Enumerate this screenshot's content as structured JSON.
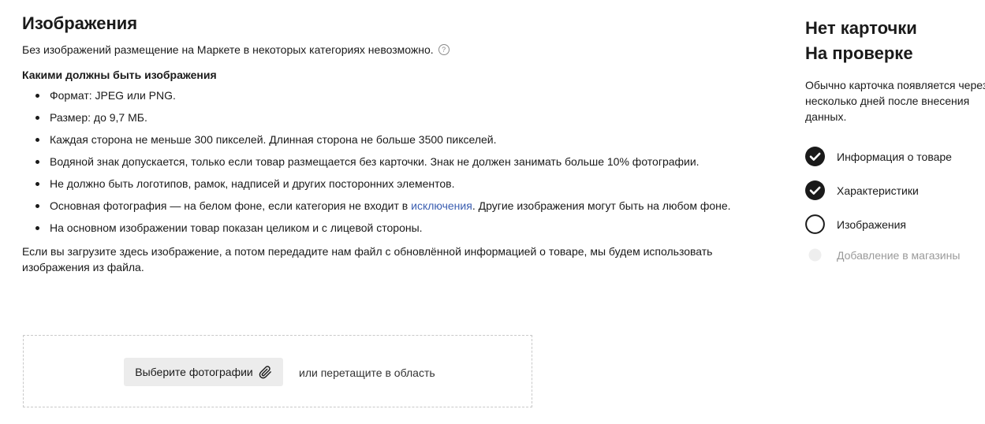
{
  "images_section": {
    "title": "Изображения",
    "intro": "Без изображений размещение на Маркете в некоторых категориях невозможно.",
    "help_icon": "question-circle-icon",
    "requirements_heading": "Какими должны быть изображения",
    "requirements": [
      "Формат: JPEG или PNG.",
      "Размер: до 9,7 МБ.",
      "Каждая сторона не меньше 300 пикселей. Длинная сторона не больше 3500 пикселей.",
      "Водяной знак допускается, только если товар размещается без карточки. Знак не должен занимать больше 10% фотографии.",
      "Не должно быть логотипов, рамок, надписей и других посторонних элементов."
    ],
    "requirement_background": {
      "before": "Основная фотография — на белом фоне, если категория не входит в ",
      "link": "исключения",
      "after": ". Другие изображения могут быть на любом фоне."
    },
    "requirement_last": "На основном изображении товар показан целиком и с лицевой стороны.",
    "footnote": "Если вы загрузите здесь изображение, а потом передадите нам файл с обновлённой информацией о товаре, мы будем использовать изображения из файла."
  },
  "upload": {
    "button_label": "Выберите фотографии",
    "button_icon": "paperclip-icon",
    "drag_hint": "или перетащите в область"
  },
  "status_panel": {
    "title_line1": "Нет карточки",
    "title_line2": "На проверке",
    "description": "Обычно карточка появляется через несколько дней после внесения данных.",
    "steps": [
      {
        "label": "Информация о товаре",
        "state": "done"
      },
      {
        "label": "Характеристики",
        "state": "done"
      },
      {
        "label": "Изображения",
        "state": "pending"
      },
      {
        "label": "Добавление в магазины",
        "state": "disabled"
      }
    ]
  },
  "colors": {
    "link": "#3b5eb0",
    "step_done": "#1a1a1a",
    "step_disabled": "#eeeeee",
    "button_bg": "#ececec"
  }
}
